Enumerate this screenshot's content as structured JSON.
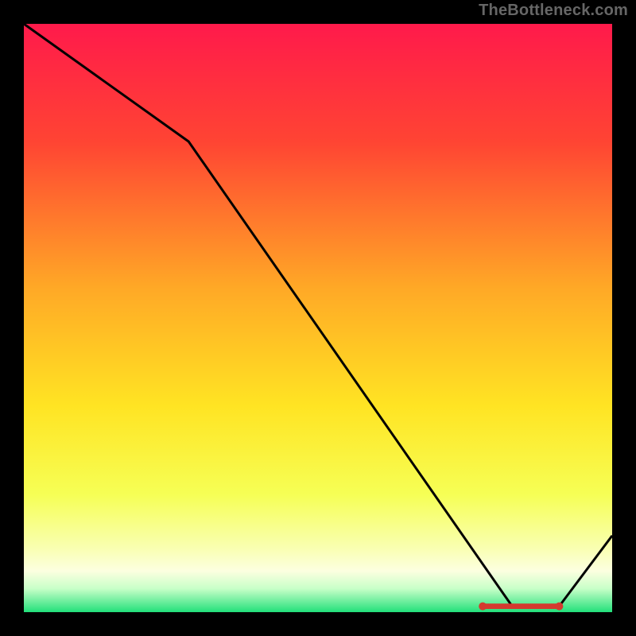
{
  "watermark": "TheBottleneck.com",
  "chart_data": {
    "type": "line",
    "title": "",
    "xlabel": "",
    "ylabel": "",
    "xlim": [
      0,
      100
    ],
    "ylim": [
      0,
      100
    ],
    "x": [
      0,
      28,
      83,
      91,
      100
    ],
    "values": [
      100,
      80,
      1,
      1,
      13
    ],
    "series_name": "bottleneck-curve",
    "marker_range_x": [
      78,
      91
    ],
    "marker_y": 1,
    "gradient_stops": [
      {
        "offset": 0,
        "color": "#ff1a4b"
      },
      {
        "offset": 20,
        "color": "#ff4433"
      },
      {
        "offset": 45,
        "color": "#ffa926"
      },
      {
        "offset": 65,
        "color": "#ffe423"
      },
      {
        "offset": 80,
        "color": "#f6ff55"
      },
      {
        "offset": 89,
        "color": "#f9ffb0"
      },
      {
        "offset": 93,
        "color": "#fcffe0"
      },
      {
        "offset": 96,
        "color": "#c8ffc8"
      },
      {
        "offset": 100,
        "color": "#22e07a"
      }
    ],
    "marker_color": "#d43a2f",
    "line_color": "#000000"
  }
}
